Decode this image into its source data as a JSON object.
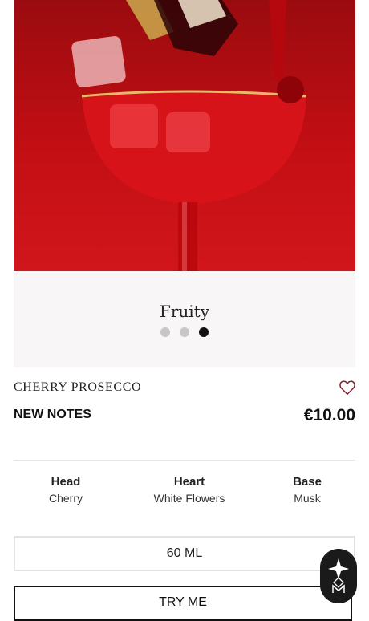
{
  "carousel": {
    "caption": "Fruity",
    "dots": 3,
    "active_index": 2
  },
  "product": {
    "name": "CHERRY PROSECCO",
    "collection": "NEW NOTES",
    "price": "€10.00"
  },
  "notes": [
    {
      "title": "Head",
      "value": "Cherry"
    },
    {
      "title": "Heart",
      "value": "White Flowers"
    },
    {
      "title": "Base",
      "value": "Musk"
    }
  ],
  "size": {
    "label": "60 ML"
  },
  "actions": {
    "try_label": "TRY ME"
  },
  "icons": {
    "wishlist": "heart-outline-icon",
    "assistant": "sparkle-logo-icon"
  },
  "colors": {
    "hero_red": "#c30f14",
    "text": "#111111"
  }
}
